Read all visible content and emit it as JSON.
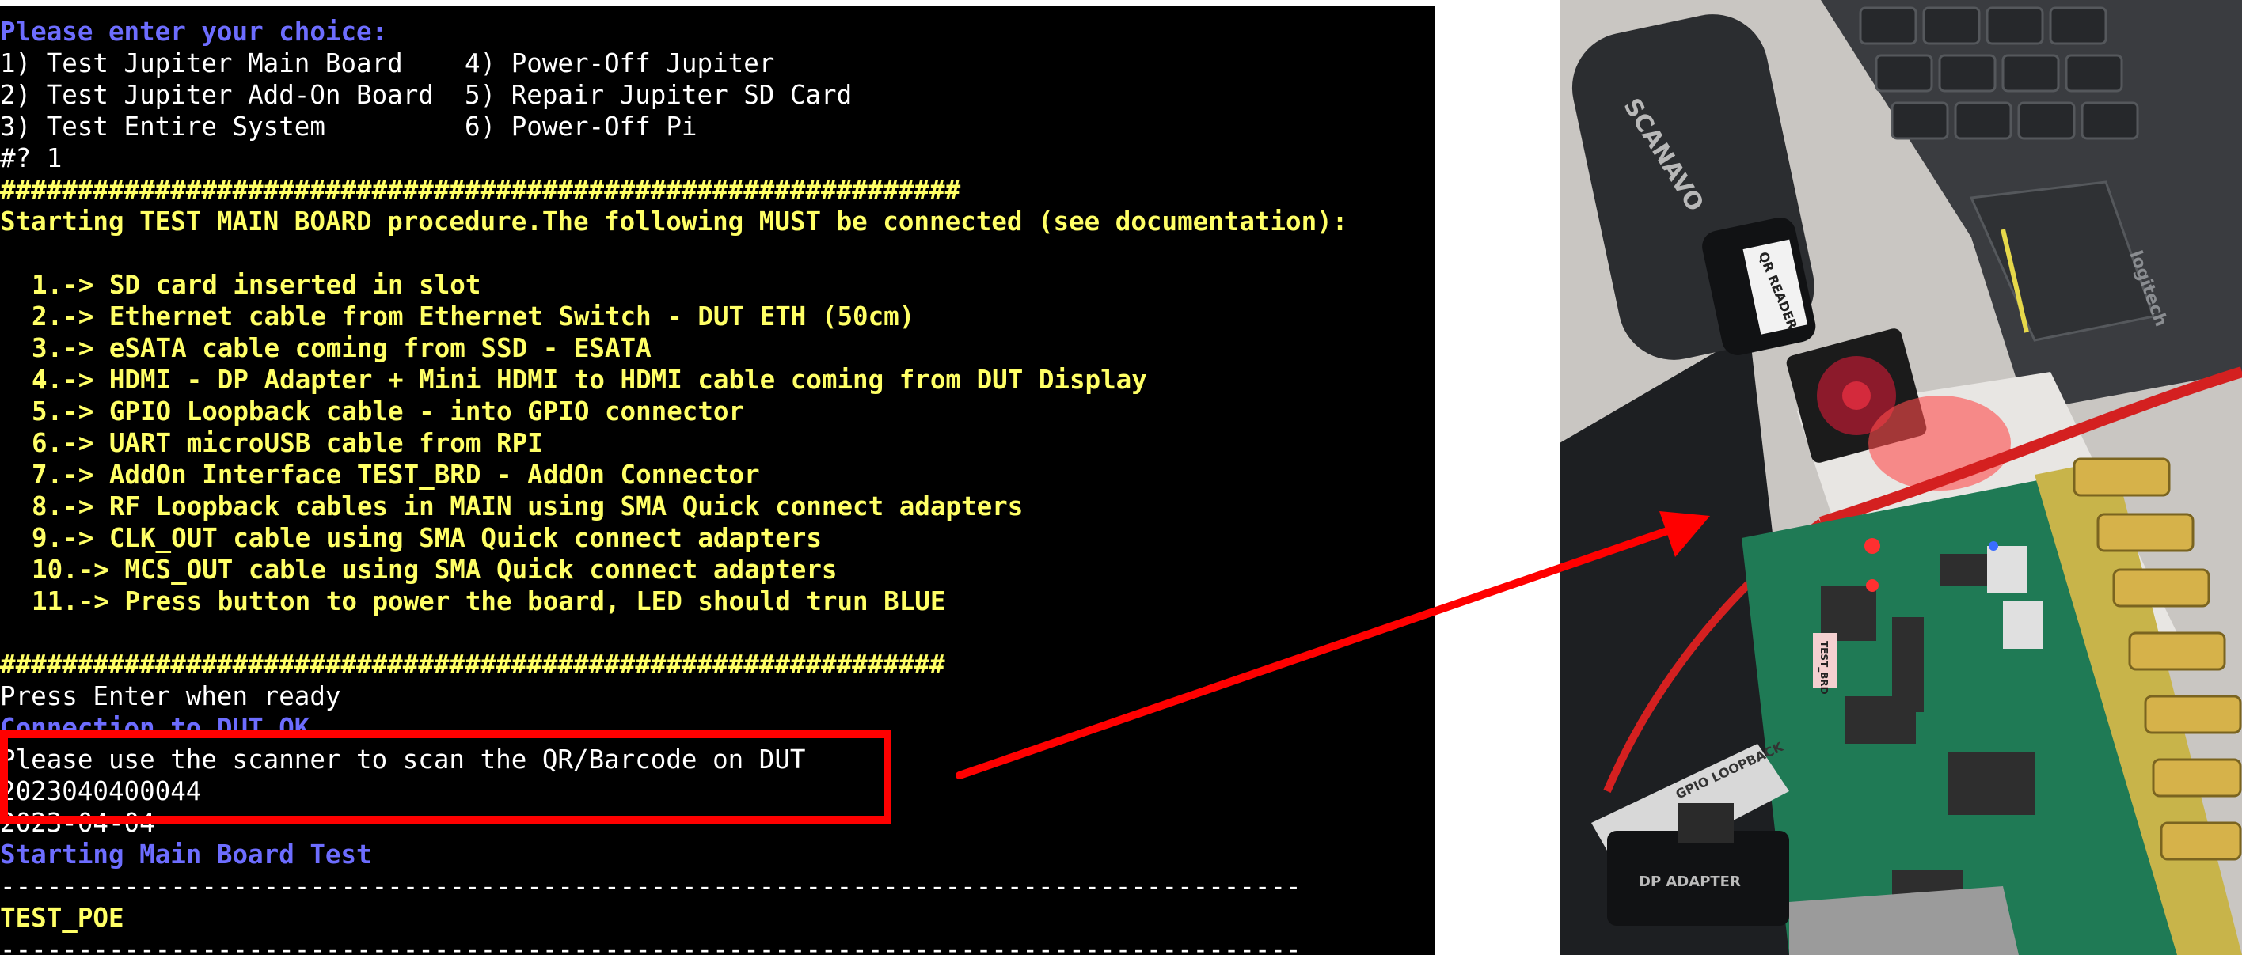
{
  "terminal": {
    "prompt": "Please enter your choice:",
    "menu_rows": [
      "1) Test Jupiter Main Board    4) Power-Off Jupiter",
      "2) Test Jupiter Add-On Board  5) Repair Jupiter SD Card",
      "3) Test Entire System         6) Power-Off Pi"
    ],
    "choice_input": "#? 1",
    "separator_top": "##############################################################",
    "header": "Starting TEST MAIN BOARD procedure.The following MUST be connected (see documentation):",
    "checklist": [
      "1.-> SD card inserted in slot",
      "2.-> Ethernet cable from Ethernet Switch - DUT ETH (50cm)",
      "3.-> eSATA cable coming from SSD - ESATA",
      "4.-> HDMI - DP Adapter + Mini HDMI to HDMI cable coming from DUT Display",
      "5.-> GPIO Loopback cable - into GPIO connector",
      "6.-> UART microUSB cable from RPI",
      "7.-> AddOn Interface TEST_BRD - AddOn Connector",
      "8.-> RF Loopback cables in MAIN using SMA Quick connect adapters",
      "9.-> CLK_OUT cable using SMA Quick connect adapters",
      "10.-> MCS_OUT cable using SMA Quick connect adapters",
      "11.-> Press button to power the board, LED should trun BLUE"
    ],
    "separator_bottom": "#############################################################",
    "press_enter": "Press Enter when ready",
    "connection_ok": "Connection to DUT OK",
    "scan_prompt": "Please use the scanner to scan the QR/Barcode on DUT",
    "barcode": "2023040400044",
    "date": "2023-04-04",
    "starting_test": "Starting Main Board Test",
    "dash_line": "------------------------------------------------------------------------------------",
    "test_name": "TEST_POE"
  },
  "photo": {
    "scanner_brand": "SCANAVO",
    "sticker_labels": [
      "QR READER",
      "GPIO LOOPBACK",
      "DP ADAPTER",
      "TEST_BRD",
      "logitech"
    ]
  },
  "colors": {
    "terminal_bg": "#000000",
    "text_white": "#ffffff",
    "text_yellow": "#ffff66",
    "text_blue": "#6d6dff",
    "highlight_red": "#ff0000"
  },
  "icons": [
    "arrow-annotation"
  ]
}
